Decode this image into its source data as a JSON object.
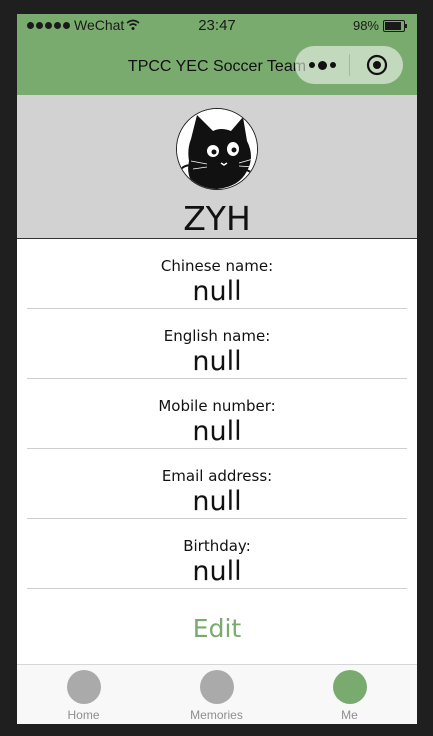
{
  "status_bar": {
    "carrier": "WeChat",
    "time": "23:47",
    "battery": "98%"
  },
  "nav": {
    "title": "TPCC YEC Soccer Team"
  },
  "profile": {
    "name": "ZYH"
  },
  "fields": [
    {
      "label": "Chinese name:",
      "value": "null"
    },
    {
      "label": "English name:",
      "value": "null"
    },
    {
      "label": "Mobile number:",
      "value": "null"
    },
    {
      "label": "Email address:",
      "value": "null"
    },
    {
      "label": "Birthday:",
      "value": "null"
    }
  ],
  "edit_label": "Edit",
  "tabs": [
    {
      "label": "Home",
      "color": "#aaaaaa"
    },
    {
      "label": "Memories",
      "color": "#aaaaaa"
    },
    {
      "label": "Me",
      "color": "#7aab6e"
    }
  ],
  "colors": {
    "accent": "#7aab6e",
    "header_bg": "#d2d2d2"
  }
}
